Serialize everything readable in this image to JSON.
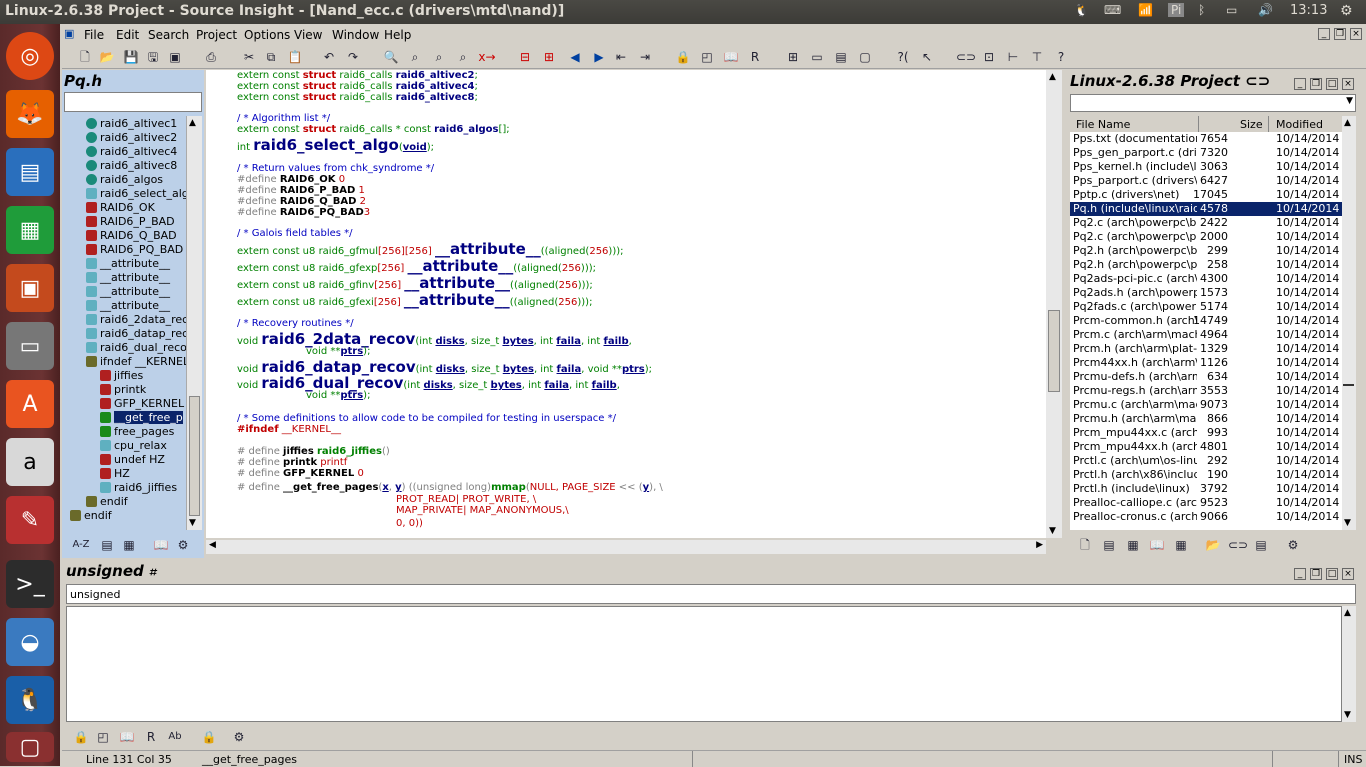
{
  "window": {
    "title": "Linux-2.6.38 Project - Source Insight - [Nand_ecc.c (drivers\\mtd\\nand)]",
    "clock": "13:13"
  },
  "menus": [
    "File",
    "Edit",
    "Search",
    "Project",
    "Options",
    "View",
    "Window",
    "Help"
  ],
  "symbol_panel": {
    "title": "Pq.h",
    "items": [
      {
        "label": "raid6_altivec1",
        "kind": "var"
      },
      {
        "label": "raid6_altivec2",
        "kind": "var"
      },
      {
        "label": "raid6_altivec4",
        "kind": "var"
      },
      {
        "label": "raid6_altivec8",
        "kind": "var"
      },
      {
        "label": "raid6_algos",
        "kind": "var"
      },
      {
        "label": "raid6_select_alg",
        "kind": "func"
      },
      {
        "label": "RAID6_OK",
        "kind": "def"
      },
      {
        "label": "RAID6_P_BAD",
        "kind": "def"
      },
      {
        "label": "RAID6_Q_BAD",
        "kind": "def"
      },
      {
        "label": "RAID6_PQ_BAD",
        "kind": "def"
      },
      {
        "label": "__attribute__",
        "kind": "func"
      },
      {
        "label": "__attribute__",
        "kind": "func"
      },
      {
        "label": "__attribute__",
        "kind": "func"
      },
      {
        "label": "__attribute__",
        "kind": "func"
      },
      {
        "label": "raid6_2data_rec",
        "kind": "func"
      },
      {
        "label": "raid6_datap_rec",
        "kind": "func"
      },
      {
        "label": "raid6_dual_reco",
        "kind": "func"
      },
      {
        "label": "ifndef __KERNEL",
        "kind": "cond"
      },
      {
        "label": "jiffies",
        "kind": "def"
      },
      {
        "label": "printk",
        "kind": "def"
      },
      {
        "label": "GFP_KERNEL",
        "kind": "def"
      },
      {
        "label": "__get_free_p",
        "kind": "macro",
        "selected": true
      },
      {
        "label": "free_pages",
        "kind": "macro"
      },
      {
        "label": "cpu_relax",
        "kind": "func"
      },
      {
        "label": "undef HZ",
        "kind": "def"
      },
      {
        "label": "HZ",
        "kind": "def"
      },
      {
        "label": "raid6_jiffies",
        "kind": "func"
      },
      {
        "label": "endif",
        "kind": "cond"
      },
      {
        "label": "endif",
        "kind": "cond"
      }
    ]
  },
  "project_panel": {
    "title": "Linux-2.6.38 Project",
    "headers": [
      "File Name",
      "Size",
      "Modified"
    ],
    "files": [
      [
        "Pps.txt (documentation\\",
        "7654",
        "10/14/2014"
      ],
      [
        "Pps_gen_parport.c (drive",
        "7320",
        "10/14/2014"
      ],
      [
        "Pps_kernel.h (include\\li",
        "3063",
        "10/14/2014"
      ],
      [
        "Pps_parport.c (drivers\\pp",
        "6427",
        "10/14/2014"
      ],
      [
        "Pptp.c (drivers\\net)",
        "17045",
        "10/14/2014"
      ],
      [
        "Pq.h (include\\linux\\raid",
        "4578",
        "10/14/2014"
      ],
      [
        "Pq2.c (arch\\powerpc\\boo",
        "2422",
        "10/14/2014"
      ],
      [
        "Pq2.c (arch\\powerpc\\pla",
        "2000",
        "10/14/2014"
      ],
      [
        "Pq2.h (arch\\powerpc\\boo",
        "299",
        "10/14/2014"
      ],
      [
        "Pq2.h (arch\\powerpc\\pla",
        "258",
        "10/14/2014"
      ],
      [
        "Pq2ads-pci-pic.c (arch\\p",
        "4300",
        "10/14/2014"
      ],
      [
        "Pq2ads.h (arch\\powerpc",
        "1573",
        "10/14/2014"
      ],
      [
        "Pq2fads.c (arch\\powerp",
        "5174",
        "10/14/2014"
      ],
      [
        "Prcm-common.h (arch\\a",
        "14749",
        "10/14/2014"
      ],
      [
        "Prcm.c (arch\\arm\\mach-",
        "4964",
        "10/14/2014"
      ],
      [
        "Prcm.h (arch\\arm\\plat-o",
        "1329",
        "10/14/2014"
      ],
      [
        "Prcm44xx.h (arch\\arm\\m",
        "1126",
        "10/14/2014"
      ],
      [
        "Prcmu-defs.h (arch\\arm\\",
        "634",
        "10/14/2014"
      ],
      [
        "Prcmu-regs.h (arch\\arm\\",
        "3553",
        "10/14/2014"
      ],
      [
        "Prcmu.c (arch\\arm\\mach",
        "9073",
        "10/14/2014"
      ],
      [
        "Prcmu.h (arch\\arm\\mach",
        "866",
        "10/14/2014"
      ],
      [
        "Prcm_mpu44xx.c (arch\\a",
        "993",
        "10/14/2014"
      ],
      [
        "Prcm_mpu44xx.h (arch\\a",
        "4801",
        "10/14/2014"
      ],
      [
        "Prctl.c (arch\\um\\os-linux",
        "292",
        "10/14/2014"
      ],
      [
        "Prctl.h (arch\\x86\\include",
        "190",
        "10/14/2014"
      ],
      [
        "Prctl.h (include\\linux)",
        "3792",
        "10/14/2014"
      ],
      [
        "Prealloc-calliope.c (arch",
        "9523",
        "10/14/2014"
      ],
      [
        "Prealloc-cronus.c (arch\\",
        "9066",
        "10/14/2014"
      ]
    ],
    "selected": 5
  },
  "context_panel": {
    "title": "unsigned",
    "text": "unsigned"
  },
  "status": {
    "position": "Line 131  Col 35",
    "symbol": "__get_free_pages",
    "mode": "INS"
  }
}
